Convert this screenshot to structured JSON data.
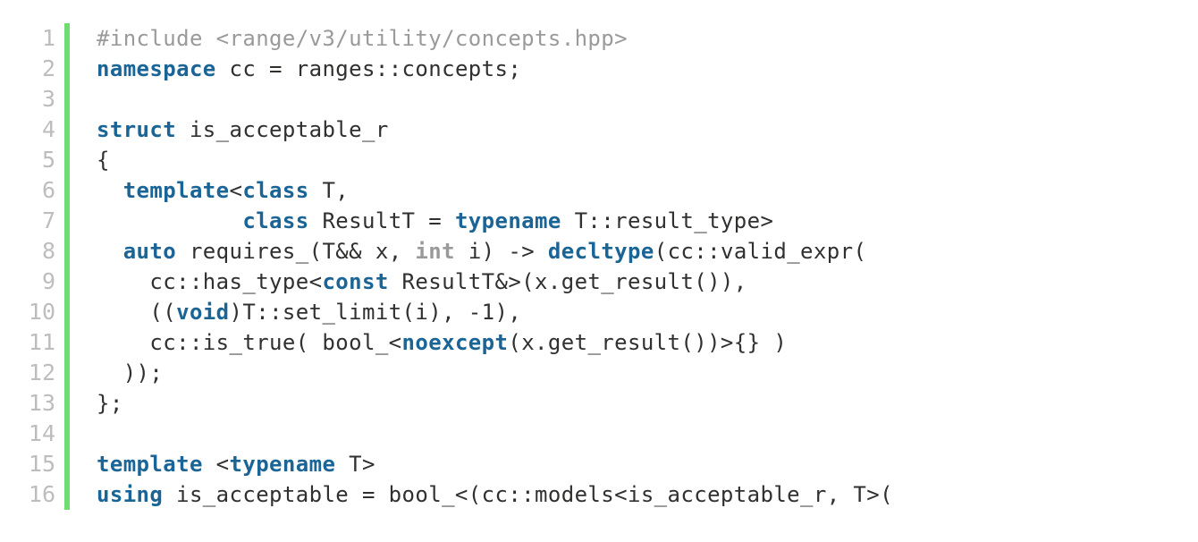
{
  "editor": {
    "language": "cpp",
    "gutter_marker_color": "#6ede72",
    "background_color": "#ffffff",
    "keyword_color": "#1a6496",
    "dim_keyword_color": "#9a9a9a",
    "preprocessor_color": "#9a9a9a",
    "plain_text_color": "#30302f",
    "line_number_color": "#bdbdbd",
    "first_line_number": 1,
    "last_line_number": 16
  },
  "lines": [
    {
      "number": "1",
      "text": "#include <range/v3/utility/concepts.hpp>",
      "tokens": [
        {
          "t": "#include <range/v3/utility/concepts.hpp>",
          "c": "pre"
        }
      ]
    },
    {
      "number": "2",
      "text": "namespace cc = ranges::concepts;",
      "tokens": [
        {
          "t": "namespace",
          "c": "kw"
        },
        {
          "t": " cc = ranges::concepts;",
          "c": "plain"
        }
      ]
    },
    {
      "number": "3",
      "text": "",
      "tokens": []
    },
    {
      "number": "4",
      "text": "struct is_acceptable_r",
      "tokens": [
        {
          "t": "struct",
          "c": "kw"
        },
        {
          "t": " is_acceptable_r",
          "c": "plain"
        }
      ]
    },
    {
      "number": "5",
      "text": "{",
      "tokens": [
        {
          "t": "{",
          "c": "plain"
        }
      ]
    },
    {
      "number": "6",
      "text": "  template<class T,",
      "tokens": [
        {
          "t": "  ",
          "c": "plain"
        },
        {
          "t": "template",
          "c": "kw"
        },
        {
          "t": "<",
          "c": "plain"
        },
        {
          "t": "class",
          "c": "kw"
        },
        {
          "t": " T,",
          "c": "plain"
        }
      ]
    },
    {
      "number": "7",
      "text": "           class ResultT = typename T::result_type>",
      "tokens": [
        {
          "t": "           ",
          "c": "plain"
        },
        {
          "t": "class",
          "c": "kw"
        },
        {
          "t": " ResultT = ",
          "c": "plain"
        },
        {
          "t": "typename",
          "c": "kw"
        },
        {
          "t": " T::result_type>",
          "c": "plain"
        }
      ]
    },
    {
      "number": "8",
      "text": "  auto requires_(T&& x, int i) -> decltype(cc::valid_expr(",
      "tokens": [
        {
          "t": "  ",
          "c": "plain"
        },
        {
          "t": "auto",
          "c": "kw"
        },
        {
          "t": " requires_(T&& x, ",
          "c": "plain"
        },
        {
          "t": "int",
          "c": "kw-dim"
        },
        {
          "t": " i) -> ",
          "c": "plain"
        },
        {
          "t": "decltype",
          "c": "kw"
        },
        {
          "t": "(cc::valid_expr(",
          "c": "plain"
        }
      ]
    },
    {
      "number": "9",
      "text": "    cc::has_type<const ResultT&>(x.get_result()),",
      "tokens": [
        {
          "t": "    cc::has_type<",
          "c": "plain"
        },
        {
          "t": "const",
          "c": "kw"
        },
        {
          "t": " ResultT&>(x.get_result()),",
          "c": "plain"
        }
      ]
    },
    {
      "number": "10",
      "text": "    ((void)T::set_limit(i), -1),",
      "tokens": [
        {
          "t": "    ((",
          "c": "plain"
        },
        {
          "t": "void",
          "c": "kw"
        },
        {
          "t": ")T::set_limit(i), -1),",
          "c": "plain"
        }
      ]
    },
    {
      "number": "11",
      "text": "    cc::is_true( bool_<noexcept(x.get_result())>{} )",
      "tokens": [
        {
          "t": "    cc::is_true( bool_<",
          "c": "plain"
        },
        {
          "t": "noexcept",
          "c": "kw"
        },
        {
          "t": "(x.get_result())>{} )",
          "c": "plain"
        }
      ]
    },
    {
      "number": "12",
      "text": "  ));",
      "tokens": [
        {
          "t": "  ));",
          "c": "plain"
        }
      ]
    },
    {
      "number": "13",
      "text": "};",
      "tokens": [
        {
          "t": "};",
          "c": "plain"
        }
      ]
    },
    {
      "number": "14",
      "text": "",
      "tokens": []
    },
    {
      "number": "15",
      "text": "template <typename T>",
      "tokens": [
        {
          "t": "template",
          "c": "kw"
        },
        {
          "t": " <",
          "c": "plain"
        },
        {
          "t": "typename",
          "c": "kw"
        },
        {
          "t": " T>",
          "c": "plain"
        }
      ]
    },
    {
      "number": "16",
      "text": "using is_acceptable = bool_<(cc::models<is_acceptable_r, T>(",
      "tokens": [
        {
          "t": "using",
          "c": "kw"
        },
        {
          "t": " is_acceptable = bool_<(cc::models<is_acceptable_r, T>(",
          "c": "plain"
        }
      ]
    }
  ]
}
